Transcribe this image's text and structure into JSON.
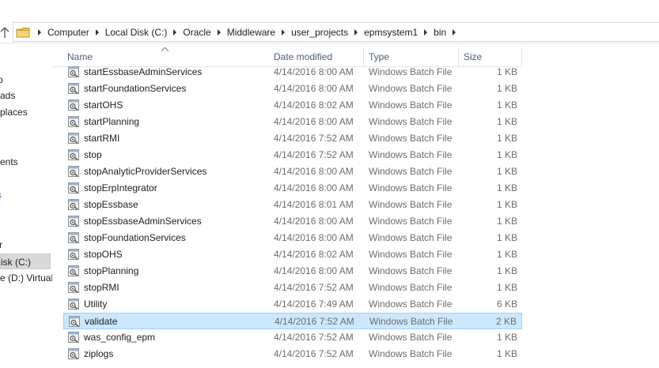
{
  "breadcrumbs": [
    "Computer",
    "Local Disk (C:)",
    "Oracle",
    "Middleware",
    "user_projects",
    "epmsystem1",
    "bin"
  ],
  "nav_items": [
    {
      "label": "p"
    },
    {
      "label": "ads"
    },
    {
      "label": "places"
    },
    {
      "label": "ents"
    },
    {
      "label": "s"
    },
    {
      "label": "r"
    },
    {
      "label": "isk (C:)"
    },
    {
      "label": "e (D:) Virtual"
    }
  ],
  "columns": {
    "name": "Name",
    "date": "Date modified",
    "type": "Type",
    "size": "Size"
  },
  "files": [
    {
      "name": "startEssbaseAdminServices",
      "date": "4/14/2016 8:00 AM",
      "type": "Windows Batch File",
      "size": "1 KB"
    },
    {
      "name": "startFoundationServices",
      "date": "4/14/2016 8:00 AM",
      "type": "Windows Batch File",
      "size": "1 KB"
    },
    {
      "name": "startOHS",
      "date": "4/14/2016 8:02 AM",
      "type": "Windows Batch File",
      "size": "1 KB"
    },
    {
      "name": "startPlanning",
      "date": "4/14/2016 8:00 AM",
      "type": "Windows Batch File",
      "size": "1 KB"
    },
    {
      "name": "startRMI",
      "date": "4/14/2016 7:52 AM",
      "type": "Windows Batch File",
      "size": "1 KB"
    },
    {
      "name": "stop",
      "date": "4/14/2016 7:52 AM",
      "type": "Windows Batch File",
      "size": "1 KB"
    },
    {
      "name": "stopAnalyticProviderServices",
      "date": "4/14/2016 8:00 AM",
      "type": "Windows Batch File",
      "size": "1 KB"
    },
    {
      "name": "stopErpIntegrator",
      "date": "4/14/2016 8:00 AM",
      "type": "Windows Batch File",
      "size": "1 KB"
    },
    {
      "name": "stopEssbase",
      "date": "4/14/2016 8:01 AM",
      "type": "Windows Batch File",
      "size": "1 KB"
    },
    {
      "name": "stopEssbaseAdminServices",
      "date": "4/14/2016 8:00 AM",
      "type": "Windows Batch File",
      "size": "1 KB"
    },
    {
      "name": "stopFoundationServices",
      "date": "4/14/2016 8:00 AM",
      "type": "Windows Batch File",
      "size": "1 KB"
    },
    {
      "name": "stopOHS",
      "date": "4/14/2016 8:02 AM",
      "type": "Windows Batch File",
      "size": "1 KB"
    },
    {
      "name": "stopPlanning",
      "date": "4/14/2016 8:00 AM",
      "type": "Windows Batch File",
      "size": "1 KB"
    },
    {
      "name": "stopRMI",
      "date": "4/14/2016 7:52 AM",
      "type": "Windows Batch File",
      "size": "1 KB"
    },
    {
      "name": "Utility",
      "date": "4/14/2016 7:49 AM",
      "type": "Windows Batch File",
      "size": "6 KB"
    },
    {
      "name": "validate",
      "date": "4/14/2016 7:52 AM",
      "type": "Windows Batch File",
      "size": "2 KB"
    },
    {
      "name": "was_config_epm",
      "date": "4/14/2016 7:52 AM",
      "type": "Windows Batch File",
      "size": "1 KB"
    },
    {
      "name": "ziplogs",
      "date": "4/14/2016 7:52 AM",
      "type": "Windows Batch File",
      "size": "1 KB"
    }
  ],
  "selected_file": "validate",
  "colors": {
    "selection_bg": "#cce8ff",
    "selection_border": "#99d1ff",
    "header_text": "#4c607a"
  }
}
